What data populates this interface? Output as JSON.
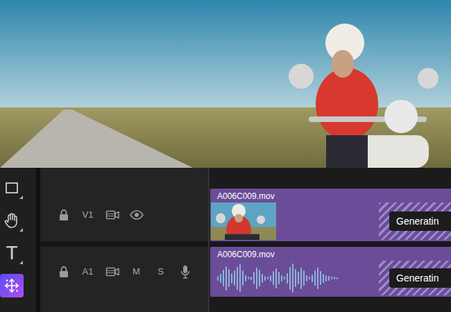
{
  "tools": [
    {
      "kind": "shape",
      "selected": false
    },
    {
      "kind": "hand",
      "selected": false
    },
    {
      "kind": "text",
      "label": "T",
      "selected": false
    },
    {
      "kind": "generate",
      "selected": true
    }
  ],
  "tracks": [
    {
      "label": "V1",
      "kind": "video",
      "toggles": [],
      "clip": {
        "name": "A006C009.mov",
        "status": "Generatin"
      }
    },
    {
      "label": "A1",
      "kind": "audio",
      "toggles": [
        "M",
        "S"
      ],
      "clip": {
        "name": "A006C009.mov",
        "status": "Generatin",
        "waveform": [
          0.15,
          0.3,
          0.55,
          0.8,
          0.6,
          0.35,
          0.5,
          0.75,
          0.9,
          0.5,
          0.2,
          0.1,
          0.12,
          0.4,
          0.7,
          0.55,
          0.3,
          0.15,
          0.1,
          0.2,
          0.45,
          0.65,
          0.4,
          0.2,
          0.1,
          0.35,
          0.75,
          0.95,
          0.6,
          0.4,
          0.7,
          0.5,
          0.2,
          0.1,
          0.25,
          0.5,
          0.7,
          0.45,
          0.3,
          0.2,
          0.15,
          0.1,
          0.08,
          0.06
        ]
      }
    }
  ]
}
